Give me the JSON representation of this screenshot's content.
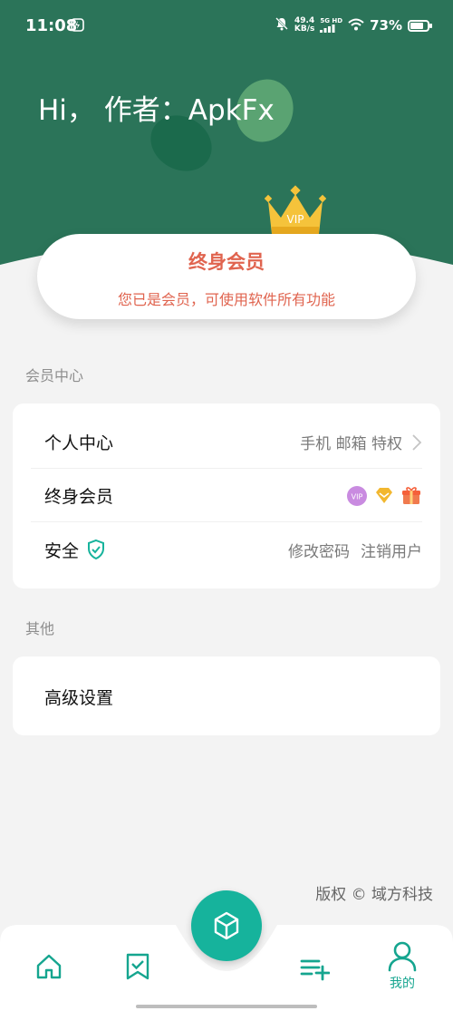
{
  "status_bar": {
    "time": "11:08",
    "net_speed_value": "49.4",
    "net_speed_unit": "KB/s",
    "signal_label": "5G HD",
    "battery": "73%"
  },
  "header": {
    "greeting": "Hi， 作者：ApkFx"
  },
  "crown": {
    "label": "VIP"
  },
  "vip_card": {
    "title": "终身会员",
    "subtitle": "您已是会员，可使用软件所有功能"
  },
  "section_member": {
    "title": "会员中心",
    "rows": [
      {
        "label": "个人中心",
        "right": "手机 邮箱 特权"
      },
      {
        "label": "终身会员"
      },
      {
        "label": "安全",
        "right_items": [
          "修改密码",
          "注销用户"
        ]
      }
    ]
  },
  "section_other": {
    "title": "其他",
    "rows": [
      {
        "label": "高级设置"
      }
    ]
  },
  "copyright": "版权 © 域方科技",
  "nav": {
    "items": [
      {
        "icon": "home-icon"
      },
      {
        "icon": "bookmark-check-icon"
      },
      {
        "icon": "cube-icon"
      },
      {
        "icon": "playlist-add-icon"
      },
      {
        "icon": "user-icon",
        "label": "我的"
      }
    ]
  },
  "colors": {
    "header_green": "#2b7459",
    "accent_teal": "#16b39c",
    "vip_red": "#e0644f"
  }
}
